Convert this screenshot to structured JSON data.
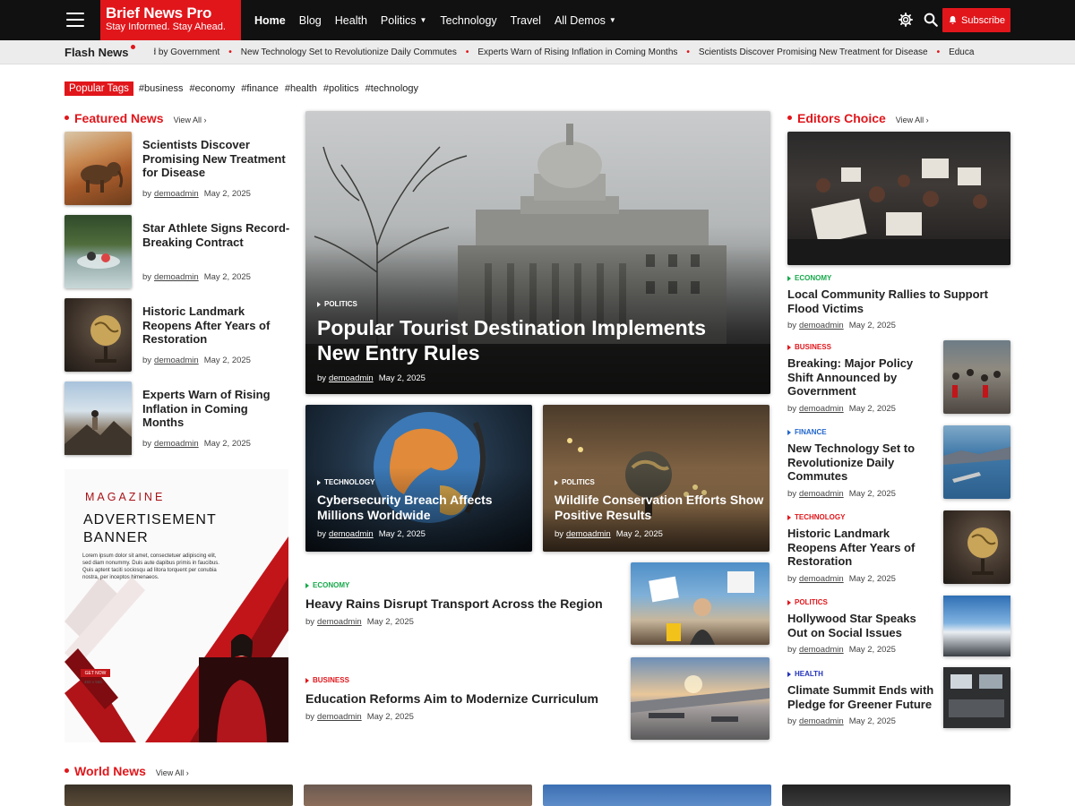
{
  "brand": {
    "title": "Brief News Pro",
    "tagline": "Stay Informed. Stay Ahead."
  },
  "nav": [
    {
      "label": "Home",
      "active": true,
      "dropdown": false
    },
    {
      "label": "Blog",
      "active": false,
      "dropdown": false
    },
    {
      "label": "Health",
      "active": false,
      "dropdown": false
    },
    {
      "label": "Politics",
      "active": false,
      "dropdown": true
    },
    {
      "label": "Technology",
      "active": false,
      "dropdown": false
    },
    {
      "label": "Travel",
      "active": false,
      "dropdown": false
    },
    {
      "label": "All Demos",
      "active": false,
      "dropdown": true
    }
  ],
  "header": {
    "subscribe_label": "Subscribe"
  },
  "flash": {
    "label": "Flash News",
    "items": [
      "ced by Government",
      "New Technology Set to Revolutionize Daily Commutes",
      "Experts Warn of Rising Inflation in Coming Months",
      "Scientists Discover Promising New Treatment for Disease",
      "Educa"
    ]
  },
  "tags": {
    "label": "Popular Tags",
    "items": [
      "#business",
      "#economy",
      "#finance",
      "#health",
      "#politics",
      "#technology"
    ]
  },
  "featured": {
    "title": "Featured News",
    "view_all": "View All",
    "items": [
      {
        "title": "Scientists Discover Promising New Treatment for Disease",
        "by": "by",
        "author": "demoadmin",
        "date": "May 2, 2025"
      },
      {
        "title": "Star Athlete Signs Record-Breaking Contract",
        "by": "by",
        "author": "demoadmin",
        "date": "May 2, 2025"
      },
      {
        "title": "Historic Landmark Reopens After Years of Restoration",
        "by": "by",
        "author": "demoadmin",
        "date": "May 2, 2025"
      },
      {
        "title": "Experts Warn of Rising Inflation in Coming Months",
        "by": "by",
        "author": "demoadmin",
        "date": "May 2, 2025"
      }
    ]
  },
  "ad": {
    "kicker": "MAGAZINE",
    "title_line1": "ADVERTISEMENT",
    "title_line2": "BANNER",
    "body": "Lorem ipsum dolor sit amet, consectetuer adipiscing elit, sed diam nonummy. Duis aute dapibus primis in faucibus. Quis aptent taciti sociosqu ad litora torquent per conubia nostra, per inceptos himenaeos.",
    "cta": "GET NOW",
    "cta_sub": "450 x 550"
  },
  "hero": {
    "category": "POLITICS",
    "title": "Popular Tourist Destination Implements New Entry Rules",
    "by": "by",
    "author": "demoadmin",
    "date": "May 2, 2025"
  },
  "cards": [
    {
      "category": "TECHNOLOGY",
      "title": "Cybersecurity Breach Affects Millions Worldwide",
      "by": "by",
      "author": "demoadmin",
      "date": "May 2, 2025"
    },
    {
      "category": "POLITICS",
      "title": "Wildlife Conservation Efforts Show Positive Results",
      "by": "by",
      "author": "demoadmin",
      "date": "May 2, 2025"
    }
  ],
  "rows": [
    {
      "category": "ECONOMY",
      "title": "Heavy Rains Disrupt Transport Across the Region",
      "by": "by",
      "author": "demoadmin",
      "date": "May 2, 2025"
    },
    {
      "category": "BUSINESS",
      "title": "Education Reforms Aim to Modernize Curriculum",
      "by": "by",
      "author": "demoadmin",
      "date": "May 2, 2025"
    }
  ],
  "editors": {
    "title": "Editors Choice",
    "view_all": "View All",
    "lead": {
      "category": "ECONOMY",
      "title": "Local Community Rallies to Support Flood Victims",
      "by": "by",
      "author": "demoadmin",
      "date": "May 2, 2025"
    },
    "items": [
      {
        "category": "BUSINESS",
        "title": "Breaking: Major Policy Shift Announced by Government",
        "by": "by",
        "author": "demoadmin",
        "date": "May 2, 2025"
      },
      {
        "category": "FINANCE",
        "title": "New Technology Set to Revolutionize Daily Commutes",
        "by": "by",
        "author": "demoadmin",
        "date": "May 2, 2025"
      },
      {
        "category": "TECHNOLOGY",
        "title": "Historic Landmark Reopens After Years of Restoration",
        "by": "by",
        "author": "demoadmin",
        "date": "May 2, 2025"
      },
      {
        "category": "POLITICS",
        "title": "Hollywood Star Speaks Out on Social Issues",
        "by": "by",
        "author": "demoadmin",
        "date": "May 2, 2025"
      },
      {
        "category": "HEALTH",
        "title": "Climate Summit Ends with Pledge for Greener Future",
        "by": "by",
        "author": "demoadmin",
        "date": "May 2, 2025"
      }
    ]
  },
  "world": {
    "title": "World News",
    "view_all": "View All"
  },
  "colors": {
    "accent": "#e1161b",
    "header_bg": "#111111",
    "economy": "#17a94b",
    "finance": "#2266cc",
    "health": "#2233bb"
  },
  "icons": [
    "menu-icon",
    "gear-icon",
    "search-icon",
    "bell-icon",
    "chevron-right-icon",
    "chevron-down-icon"
  ]
}
